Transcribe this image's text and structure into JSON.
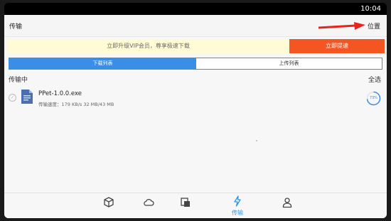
{
  "status_bar": {
    "time": "10:04"
  },
  "app_bar": {
    "title": "传输",
    "location_label": "位置"
  },
  "vip_banner": {
    "text": "立即升级VIP会员，尊享极速下载",
    "button_label": "立即提速"
  },
  "tabs": [
    {
      "label": "下载列表",
      "active": true
    },
    {
      "label": "上传列表",
      "active": false
    }
  ],
  "section": {
    "title": "传输中",
    "select_all": "全选"
  },
  "transfers": [
    {
      "filename": "PPet-1.0.0.exe",
      "status": "传输速度：179 KB/s 32 MB/43 MB",
      "progress_text": "73%"
    }
  ],
  "bottom_nav": [
    {
      "icon": "box-icon",
      "label": "",
      "active": false
    },
    {
      "icon": "cloud-icon",
      "label": "",
      "active": false
    },
    {
      "icon": "files-icon",
      "label": "",
      "active": false
    },
    {
      "icon": "lightning-icon",
      "label": "传输",
      "active": true
    },
    {
      "icon": "person-icon",
      "label": "",
      "active": false
    }
  ],
  "colors": {
    "accent": "#3a8ee6",
    "vip_button": "#f35622",
    "arrow": "#e8231c"
  }
}
